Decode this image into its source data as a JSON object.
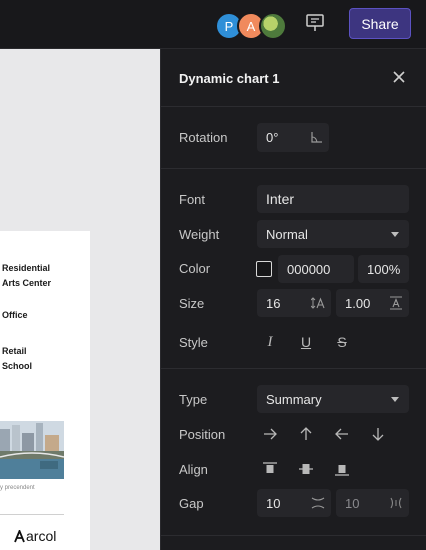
{
  "topbar": {
    "avatars": [
      "P",
      "A"
    ],
    "share_label": "Share"
  },
  "canvas": {
    "items": [
      "Residential",
      "Arts Center",
      "Office",
      "Retail",
      "School"
    ],
    "caption": "y precendent",
    "logo_text": "arcol"
  },
  "panel": {
    "title": "Dynamic chart 1",
    "rotation": {
      "label": "Rotation",
      "value": "0°"
    },
    "font": {
      "label": "Font",
      "value": "Inter"
    },
    "weight": {
      "label": "Weight",
      "value": "Normal"
    },
    "color": {
      "label": "Color",
      "hex": "000000",
      "opacity": "100%"
    },
    "size": {
      "label": "Size",
      "value": "16",
      "line_height": "1.00"
    },
    "style": {
      "label": "Style"
    },
    "type": {
      "label": "Type",
      "value": "Summary"
    },
    "position": {
      "label": "Position"
    },
    "align": {
      "label": "Align"
    },
    "gap": {
      "label": "Gap",
      "value1": "10",
      "value2": "10"
    }
  },
  "colors": {
    "accent": "#3d3580",
    "panel_bg": "#1c1c1f",
    "field_bg": "#26262a"
  }
}
